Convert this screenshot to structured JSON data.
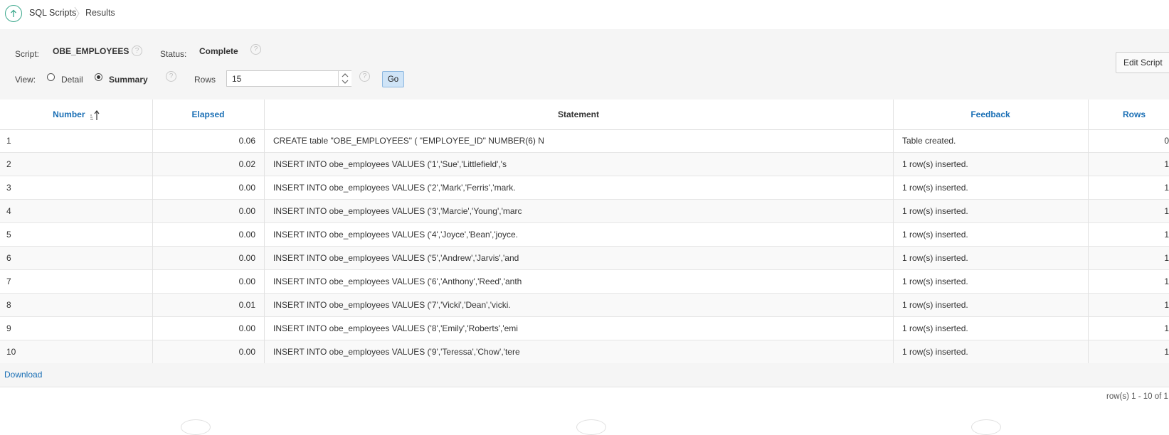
{
  "breadcrumb": {
    "items": [
      "SQL Scripts",
      "Results"
    ]
  },
  "form": {
    "script_label": "Script:",
    "script_value": "OBE_EMPLOYEES",
    "status_label": "Status:",
    "status_value": "Complete",
    "view_label": "View:",
    "view_options": [
      "Detail",
      "Summary"
    ],
    "view_selected": "Summary",
    "rows_label": "Rows",
    "rows_value": "15",
    "go_label": "Go",
    "edit_script_label": "Edit Script",
    "help_glyph": "?"
  },
  "table": {
    "columns": [
      "Number",
      "Elapsed",
      "Statement",
      "Feedback",
      "Rows"
    ],
    "rows": [
      {
        "number": "1",
        "elapsed": "0.06",
        "statement": "CREATE table \"OBE_EMPLOYEES\" ( \"EMPLOYEE_ID\" NUMBER(6) N",
        "feedback": "Table created.",
        "rows": "0"
      },
      {
        "number": "2",
        "elapsed": "0.02",
        "statement": "INSERT INTO obe_employees VALUES ('1','Sue','Littlefield','s",
        "feedback": "1 row(s) inserted.",
        "rows": "1"
      },
      {
        "number": "3",
        "elapsed": "0.00",
        "statement": "INSERT INTO obe_employees VALUES ('2','Mark','Ferris','mark.",
        "feedback": "1 row(s) inserted.",
        "rows": "1"
      },
      {
        "number": "4",
        "elapsed": "0.00",
        "statement": "INSERT INTO obe_employees VALUES ('3','Marcie','Young','marc",
        "feedback": "1 row(s) inserted.",
        "rows": "1"
      },
      {
        "number": "5",
        "elapsed": "0.00",
        "statement": "INSERT INTO obe_employees VALUES ('4','Joyce','Bean','joyce.",
        "feedback": "1 row(s) inserted.",
        "rows": "1"
      },
      {
        "number": "6",
        "elapsed": "0.00",
        "statement": "INSERT INTO obe_employees VALUES ('5','Andrew','Jarvis','and",
        "feedback": "1 row(s) inserted.",
        "rows": "1"
      },
      {
        "number": "7",
        "elapsed": "0.00",
        "statement": "INSERT INTO obe_employees VALUES ('6','Anthony','Reed','anth",
        "feedback": "1 row(s) inserted.",
        "rows": "1"
      },
      {
        "number": "8",
        "elapsed": "0.01",
        "statement": "INSERT INTO obe_employees VALUES ('7','Vicki','Dean','vicki.",
        "feedback": "1 row(s) inserted.",
        "rows": "1"
      },
      {
        "number": "9",
        "elapsed": "0.00",
        "statement": "INSERT INTO obe_employees VALUES ('8','Emily','Roberts','emi",
        "feedback": "1 row(s) inserted.",
        "rows": "1"
      },
      {
        "number": "10",
        "elapsed": "0.00",
        "statement": "INSERT INTO obe_employees VALUES ('9','Teressa','Chow','tere",
        "feedback": "1 row(s) inserted.",
        "rows": "1"
      }
    ]
  },
  "footer": {
    "download_label": "Download",
    "pagination": "row(s) 1 - 10 of 1"
  },
  "colors": {
    "link": "#1a6fb5",
    "accent_green": "#3aa78b",
    "go_button_bg": "#cfe4f7"
  }
}
